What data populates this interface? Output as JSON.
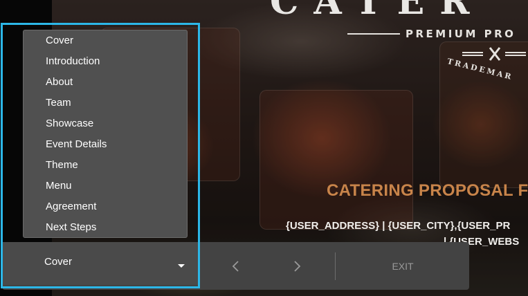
{
  "slide": {
    "brand_title": "CATER",
    "brand_subtitle": "PREMIUM PRO",
    "brand_trademark": "TRADEMAR",
    "proposal_title": "CATERING PROPOSAL F",
    "address_line": "{USER_ADDRESS} | {USER_CITY},{USER_PR",
    "website_line": "| {USER_WEBS"
  },
  "navigation": {
    "current_slide": "Cover",
    "slides": [
      "Cover",
      "Introduction",
      "About",
      "Team",
      "Showcase",
      "Event Details",
      "Theme",
      "Menu",
      "Agreement",
      "Next Steps"
    ],
    "prev_icon": "chevron-left-icon",
    "next_icon": "chevron-right-icon",
    "exit_label": "EXIT"
  },
  "colors": {
    "focus_outline": "#2cb7e8",
    "accent_title": "#c8844a",
    "nav_bar": "#434343",
    "dropdown_bg": "#505050"
  }
}
